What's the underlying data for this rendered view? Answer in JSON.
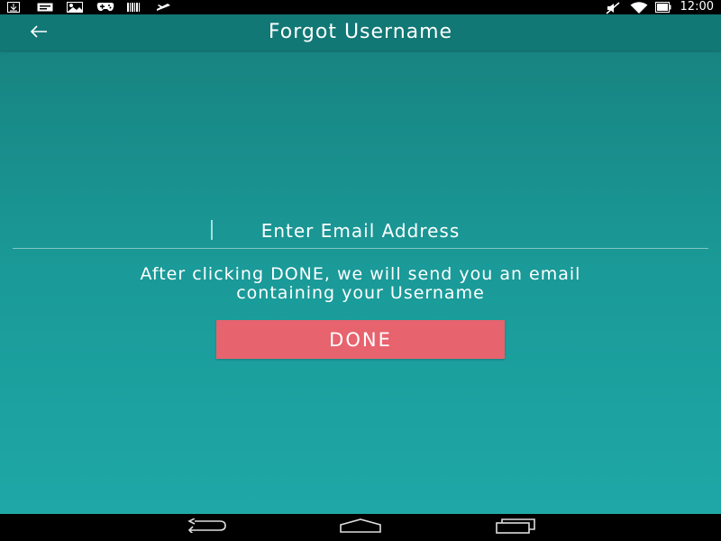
{
  "status_bar": {
    "left_icons": [
      "download-icon",
      "message-icon",
      "image-icon",
      "gamepad-icon",
      "barcode-icon",
      "plane-icon"
    ],
    "right_icons": [
      "mute-icon",
      "wifi-icon",
      "battery-icon"
    ],
    "time": "12:00"
  },
  "app_bar": {
    "back_icon": "back-arrow-icon",
    "title": "Forgot Username"
  },
  "form": {
    "email_value": "",
    "email_placeholder": "Enter Email Address",
    "info_line1": "After clicking DONE, we will send you an email",
    "info_line2": "containing your Username",
    "done_label": "DONE"
  },
  "nav_bar": {
    "buttons": [
      "back-icon",
      "home-icon",
      "recents-icon"
    ]
  },
  "colors": {
    "app_bar": "#117875",
    "background_top": "#177f7c",
    "background_bottom": "#1ea9a8",
    "button": "#e7636e",
    "text": "#ffffff"
  }
}
